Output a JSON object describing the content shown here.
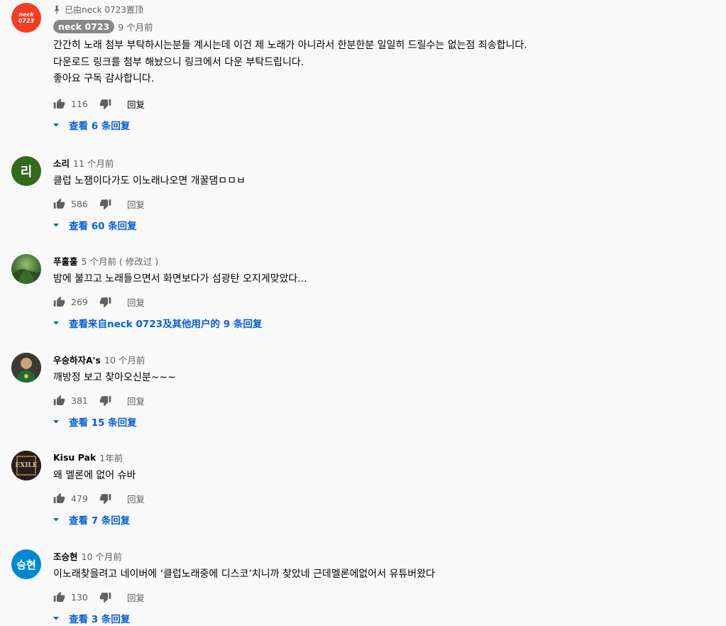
{
  "comments": [
    {
      "pinned_text": "已由neck 0723置顶",
      "author": "neck 0723",
      "time": "9 个月前",
      "avatar_text_1": "neck",
      "avatar_text_2": "0723",
      "avatar_color": "#f23d24",
      "text": "간간히 노래 첨부 부탁하시는분들 계시는데 이건 제 노래가 아니라서 한분한분 일일히 드릴수는 없는점 죄송합니다.\n다운로드 링크를 첨부 해놨으니 링크에서 다운 부탁드립니다.\n좋아요 구독 감사합니다.",
      "likes": "116",
      "reply_label": "回复",
      "view_replies": "查看 6 条回复"
    },
    {
      "author": "소리",
      "time": "11 个月前",
      "avatar_letter": "리",
      "avatar_color": "#33691e",
      "text": "클럽 노잼이다가도 이노래나오면 개꿀댐ㅁㅁㅂ",
      "likes": "586",
      "reply_label": "回复",
      "view_replies": "查看 60 条回复"
    },
    {
      "author": "푸훌훌",
      "time": "5 个月前 ( 修改过 )",
      "avatar_color": "#3e6b3a",
      "text": "밤에 불끄고 노래들으면서 화면보다가 섬광탄 오지게맞았다...",
      "likes": "269",
      "reply_label": "回复",
      "view_replies": "查看来自neck 0723及其他用户的 9 条回复"
    },
    {
      "author": "우승하자A's",
      "time": "10 个月前",
      "avatar_color": "#2f4f2f",
      "text": "깨방정 보고 찾아오신분~~~",
      "likes": "381",
      "reply_label": "回复",
      "view_replies": "查看 15 条回复"
    },
    {
      "author": "Kisu Pak",
      "time": "1年前",
      "avatar_color": "#3a2a22",
      "avatar_text": "EXILE",
      "text": "왜 멜론에 없어 슈바",
      "likes": "479",
      "reply_label": "回复",
      "view_replies": "查看 7 条回复"
    },
    {
      "author": "조승현",
      "time": "10 个月前",
      "avatar_letter": "승현",
      "avatar_color": "#0288d1",
      "text": "이노래찾을려고 네이버에 ‘클럽노래중에 디스코’치니까 찾았네 근데멜론에없어서 유튜버왔다",
      "likes": "130",
      "reply_label": "回复",
      "view_replies": "查看 3 条回复"
    }
  ],
  "colors": {
    "background": "#f9f9f9",
    "link_blue": "#065fd4",
    "meta_gray": "#606060"
  }
}
